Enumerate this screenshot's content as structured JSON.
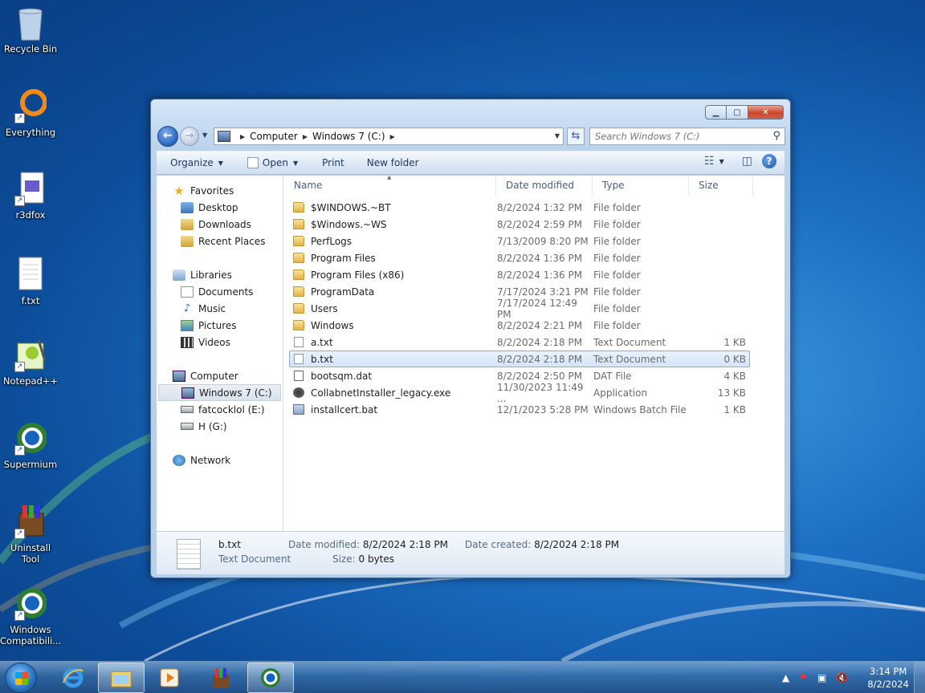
{
  "desktop": {
    "icons": [
      {
        "label": "Recycle Bin"
      },
      {
        "label": "Everything"
      },
      {
        "label": "r3dfox"
      },
      {
        "label": "f.txt"
      },
      {
        "label": "Notepad++"
      },
      {
        "label": "Supermium"
      },
      {
        "label": "Uninstall Tool"
      },
      {
        "label": "Windows Compatibili..."
      }
    ]
  },
  "window": {
    "controls": {
      "minimize": "▁",
      "maximize": "▢",
      "close": "✕"
    },
    "address": {
      "crumbs": [
        "Computer",
        "Windows 7 (C:)"
      ]
    },
    "search": {
      "placeholder": "Search Windows 7 (C:)"
    },
    "toolbar": {
      "organize": "Organize",
      "open": "Open",
      "print": "Print",
      "new_folder": "New folder"
    },
    "nav": {
      "favorites": "Favorites",
      "desktop": "Desktop",
      "downloads": "Downloads",
      "recent": "Recent Places",
      "libraries": "Libraries",
      "documents": "Documents",
      "music": "Music",
      "pictures": "Pictures",
      "videos": "Videos",
      "computer": "Computer",
      "drive_c": "Windows 7 (C:)",
      "drive_e": "fatcocklol (E:)",
      "drive_g": "H (G:)",
      "network": "Network"
    },
    "columns": {
      "name": "Name",
      "date": "Date modified",
      "type": "Type",
      "size": "Size"
    },
    "files": [
      {
        "name": "$WINDOWS.~BT",
        "date": "8/2/2024 1:32 PM",
        "type": "File folder",
        "size": ""
      },
      {
        "name": "$Windows.~WS",
        "date": "8/2/2024 2:59 PM",
        "type": "File folder",
        "size": ""
      },
      {
        "name": "PerfLogs",
        "date": "7/13/2009 8:20 PM",
        "type": "File folder",
        "size": ""
      },
      {
        "name": "Program Files",
        "date": "8/2/2024 1:36 PM",
        "type": "File folder",
        "size": ""
      },
      {
        "name": "Program Files (x86)",
        "date": "8/2/2024 1:36 PM",
        "type": "File folder",
        "size": ""
      },
      {
        "name": "ProgramData",
        "date": "7/17/2024 3:21 PM",
        "type": "File folder",
        "size": ""
      },
      {
        "name": "Users",
        "date": "7/17/2024 12:49 PM",
        "type": "File folder",
        "size": ""
      },
      {
        "name": "Windows",
        "date": "8/2/2024 2:21 PM",
        "type": "File folder",
        "size": ""
      },
      {
        "name": "a.txt",
        "date": "8/2/2024 2:18 PM",
        "type": "Text Document",
        "size": "1 KB"
      },
      {
        "name": "b.txt",
        "date": "8/2/2024 2:18 PM",
        "type": "Text Document",
        "size": "0 KB"
      },
      {
        "name": "bootsqm.dat",
        "date": "8/2/2024 2:50 PM",
        "type": "DAT File",
        "size": "4 KB"
      },
      {
        "name": "CollabnetInstaller_legacy.exe",
        "date": "11/30/2023 11:49 ...",
        "type": "Application",
        "size": "13 KB"
      },
      {
        "name": "installcert.bat",
        "date": "12/1/2023 5:28 PM",
        "type": "Windows Batch File",
        "size": "1 KB"
      }
    ],
    "details": {
      "name": "b.txt",
      "type": "Text Document",
      "modified_label": "Date modified:",
      "modified": "8/2/2024 2:18 PM",
      "created_label": "Date created:",
      "created": "8/2/2024 2:18 PM",
      "size_label": "Size:",
      "size": "0 bytes"
    }
  },
  "taskbar": {
    "time": "3:14 PM",
    "date": "8/2/2024"
  }
}
